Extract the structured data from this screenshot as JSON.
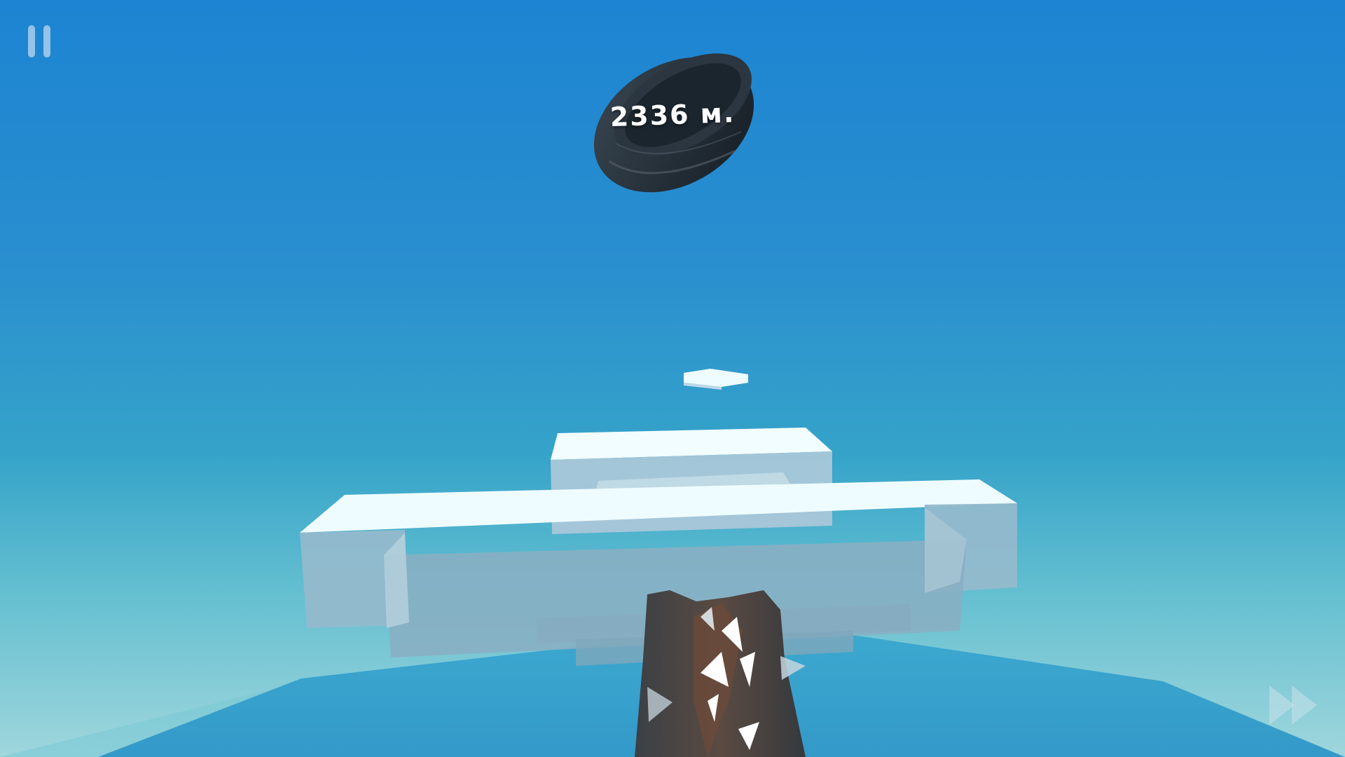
{
  "hud": {
    "distance_text": "2336 м.",
    "pause_icon": "pause-icon",
    "fast_forward_icon": "fast-forward-icon"
  },
  "colors": {
    "sky_top": "#1c84d2",
    "sky_bottom": "#9fd6dc",
    "ice": "#eefbff",
    "tire": "#1f2a33"
  }
}
